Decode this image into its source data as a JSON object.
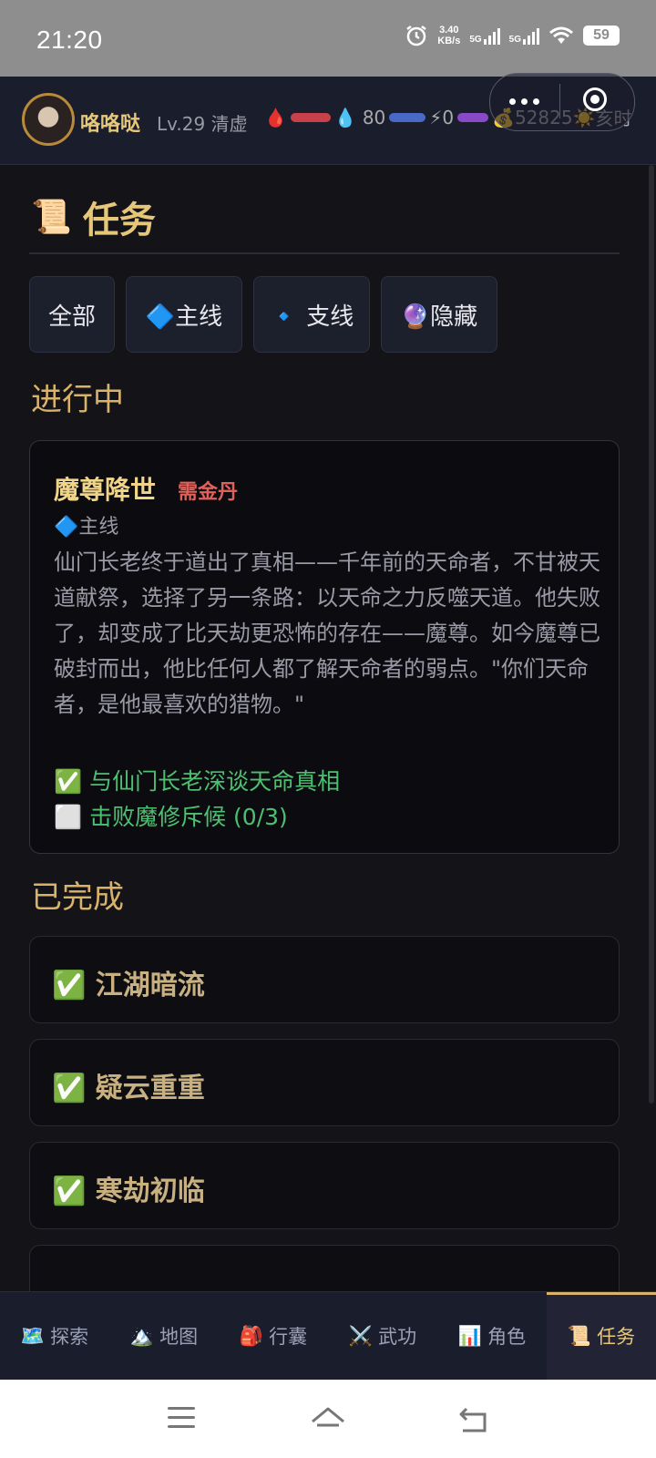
{
  "status_bar": {
    "time": "21:20",
    "net_speed_value": "3.40",
    "net_speed_unit": "KB/s",
    "signal1": "5G",
    "signal2": "5G",
    "battery": "59"
  },
  "hud": {
    "name": "咯咯哒",
    "level": "Lv.29 清虚",
    "hp_icon": "blood-drop-icon",
    "mp_icon": "water-drop-icon",
    "mp_text": "80",
    "energy_icon": "lightning-icon",
    "energy_text": "0",
    "gold_icon": "money-bag-icon",
    "gold": "52825",
    "time_icon": "sun-icon",
    "time_text": "亥时"
  },
  "page": {
    "title_icon": "📜",
    "title": "任务"
  },
  "filters": [
    {
      "label": "全部"
    },
    {
      "label": "🔷主线"
    },
    {
      "label": "🔹 支线"
    },
    {
      "label": "🔮隐藏"
    }
  ],
  "in_progress": {
    "heading": "进行中",
    "quest": {
      "title": "魔尊降世",
      "requirement": "需金丹",
      "type": "🔷主线",
      "description": "仙门长老终于道出了真相——千年前的天命者，不甘被天道献祭，选择了另一条路：以天命之力反噬天道。他失败了，却变成了比天劫更恐怖的存在——魔尊。如今魔尊已破封而出，他比任何人都了解天命者的弱点。\"你们天命者，是他最喜欢的猎物。\"",
      "objectives": [
        {
          "mark": "✅",
          "text": "与仙门长老深谈天命真相"
        },
        {
          "mark": "⬜",
          "text": "击败魔修斥候 (0/3)"
        }
      ]
    }
  },
  "completed": {
    "heading": "已完成",
    "items": [
      {
        "text": "✅ 江湖暗流"
      },
      {
        "text": "✅ 疑云重重"
      },
      {
        "text": "✅ 寒劫初临"
      }
    ]
  },
  "bottom_nav": [
    {
      "icon": "🗺️",
      "label": "探索"
    },
    {
      "icon": "🏔️",
      "label": "地图"
    },
    {
      "icon": "🎒",
      "label": "行囊"
    },
    {
      "icon": "⚔️",
      "label": "武功"
    },
    {
      "icon": "📊",
      "label": "角色"
    },
    {
      "icon": "📜",
      "label": "任务"
    }
  ],
  "colors": {
    "accent_gold": "#e6c77a",
    "header_bg": "#1a1d2c",
    "page_bg": "#141418",
    "objective_green": "#4cc070",
    "requirement_red": "#e0605a"
  }
}
